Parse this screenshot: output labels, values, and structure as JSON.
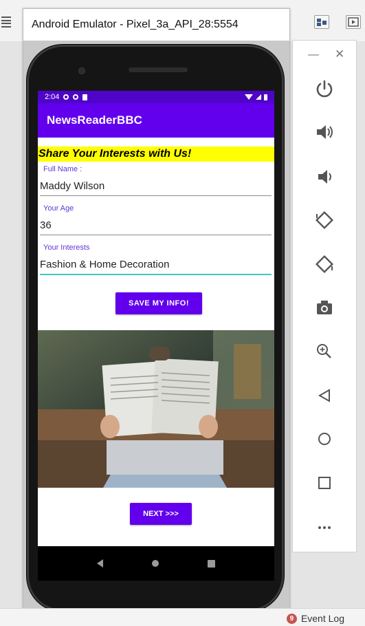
{
  "emulator": {
    "title": "Android Emulator - Pixel_3a_API_28:5554",
    "toolbar_icons": [
      "power-icon",
      "volume-up-icon",
      "volume-down-icon",
      "rotate-left-icon",
      "rotate-right-icon",
      "camera-icon",
      "zoom-icon",
      "back-icon",
      "home-icon",
      "overview-icon",
      "more-icon"
    ]
  },
  "status_bar": {
    "time": "2:04"
  },
  "app": {
    "title": "NewsReaderBBC",
    "banner": "Share Your Interests with Us!",
    "fields": [
      {
        "label": "Full Name :",
        "value": "Maddy Wilson"
      },
      {
        "label": "Your Age",
        "value": "36"
      },
      {
        "label": "Your Interests",
        "value": "Fashion & Home Decoration"
      }
    ],
    "save_label": "SAVE MY INFO!",
    "next_label": "NEXT >>>"
  },
  "ide": {
    "event_log_label": "Event Log",
    "event_log_count": "9"
  },
  "colors": {
    "primary": "#6200ee",
    "status_bar": "#4e05c8",
    "banner_bg": "#ffff00",
    "label": "#5e35d9",
    "accent_underline": "#3ec9c0"
  }
}
